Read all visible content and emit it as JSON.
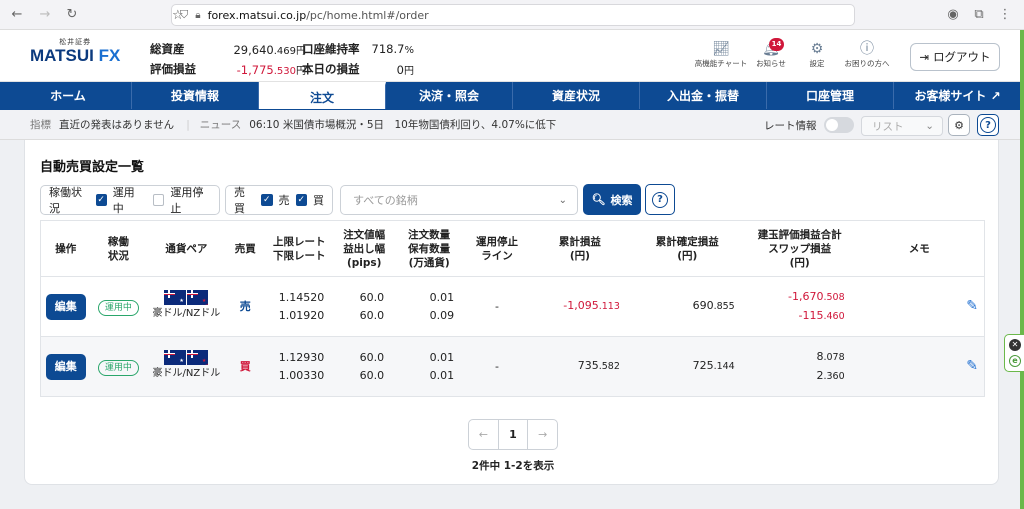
{
  "browser": {
    "url_host": "forex.matsui.co.jp",
    "url_path": "/pc/home.html#/order"
  },
  "header": {
    "logo_small": "松井証券",
    "logo_main": "MATSUI",
    "logo_fx": "FX",
    "total_assets_label": "総資産",
    "total_assets_int": "29,640",
    "total_assets_dec": ".469",
    "total_assets_unit": "円",
    "margin_ratio_label": "口座維持率",
    "margin_ratio_value": "718.7",
    "margin_ratio_unit": "%",
    "pnl_label": "評価損益",
    "pnl_int": "-1,775",
    "pnl_dec": ".530",
    "pnl_unit": "円",
    "today_pnl_label": "本日の損益",
    "today_pnl_value": "0",
    "today_pnl_unit": "円",
    "icons": [
      {
        "label": "高機能チャート",
        "icon": "chart-icon"
      },
      {
        "label": "お知らせ",
        "icon": "bell-icon",
        "badge": "14"
      },
      {
        "label": "設定",
        "icon": "gear-icon"
      },
      {
        "label": "お困りの方へ",
        "icon": "help-icon"
      }
    ],
    "logout_label": "ログアウト"
  },
  "nav": {
    "tabs": [
      "ホーム",
      "投資情報",
      "注文",
      "決済・照会",
      "資産状況",
      "入出金・振替",
      "口座管理",
      "お客様サイト"
    ],
    "active_index": 2
  },
  "ticker": {
    "indicator_label": "指標",
    "indicator_text": "直近の発表はありません",
    "news_label": "ニュース",
    "news_text": "06:10 米国債市場概況・5日　10年物国債利回り、4.07%に低下",
    "rate_label": "レート情報",
    "list_label": "リスト"
  },
  "panel": {
    "title": "自動売買設定一覧",
    "filter_status_label": "稼働状況",
    "filter_running": "運用中",
    "filter_stopped": "運用停止",
    "filter_side_label": "売買",
    "filter_sell": "売",
    "filter_buy": "買",
    "symbol_placeholder": "すべての銘柄",
    "search_label": "検索"
  },
  "table": {
    "headers": {
      "op": "操作",
      "status1": "稼働",
      "status2": "状況",
      "pair": "通貨ペア",
      "side": "売買",
      "upper": "上限レート",
      "lower": "下限レート",
      "width1": "注文値幅",
      "width2": "益出し幅",
      "width3": "(pips)",
      "qty1": "注文数量",
      "qty2": "保有数量",
      "qty3": "(万通貨)",
      "stop1": "運用停止",
      "stop2": "ライン",
      "cum1": "累計損益",
      "cum2": "(円)",
      "realized1": "累計確定損益",
      "realized2": "(円)",
      "unreal1": "建玉評価損益合計",
      "unreal2": "スワップ損益",
      "unreal3": "(円)",
      "memo": "メモ"
    },
    "rows": [
      {
        "edit": "編集",
        "status": "運用中",
        "pair": "豪ドル/NZドル",
        "side": "売",
        "upper": "1.14520",
        "lower": "1.01920",
        "order_width": "60.0",
        "profit_width": "60.0",
        "order_qty": "0.01",
        "hold_qty": "0.09",
        "stop_line": "-",
        "cum_int": "-1,095",
        "cum_dec": ".113",
        "real_int": "690",
        "real_dec": ".855",
        "unreal_int": "-1,670",
        "unreal_dec": ".508",
        "swap_int": "-115",
        "swap_dec": ".460"
      },
      {
        "edit": "編集",
        "status": "運用中",
        "pair": "豪ドル/NZドル",
        "side": "買",
        "upper": "1.12930",
        "lower": "1.00330",
        "order_width": "60.0",
        "profit_width": "60.0",
        "order_qty": "0.01",
        "hold_qty": "0.01",
        "stop_line": "-",
        "cum_int": "735",
        "cum_dec": ".582",
        "real_int": "725",
        "real_dec": ".144",
        "unreal_int": "8",
        "unreal_dec": ".078",
        "swap_int": "2",
        "swap_dec": ".360"
      }
    ]
  },
  "pager": {
    "page": "1",
    "summary": "2件中 1-2を表示"
  }
}
